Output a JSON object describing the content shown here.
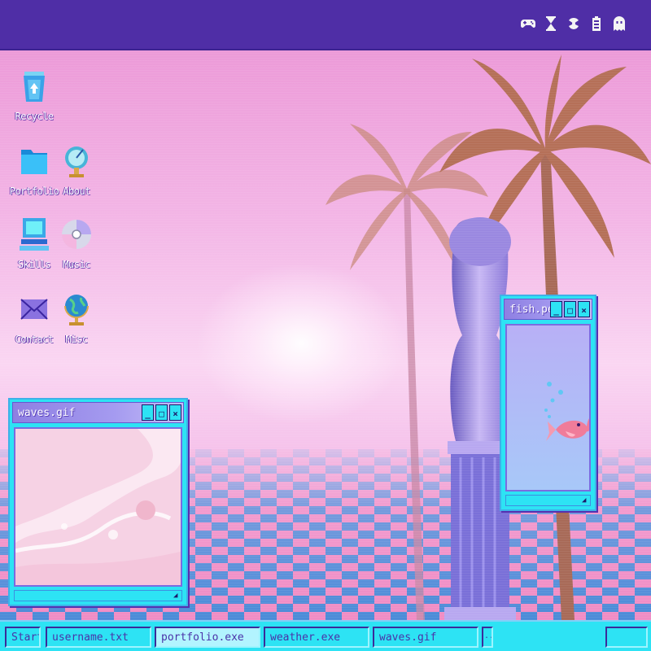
{
  "topbar": {
    "tray_icons": [
      {
        "name": "gamepad-icon",
        "glyph": "🎮"
      },
      {
        "name": "hourglass-icon",
        "glyph": "⧗"
      },
      {
        "name": "radiation-icon",
        "glyph": "☢"
      },
      {
        "name": "battery-icon",
        "glyph": "▮"
      },
      {
        "name": "ghost-icon",
        "glyph": "👻"
      }
    ]
  },
  "desktop": {
    "icons": [
      {
        "id": "recycle",
        "label": "Recycle",
        "icon": "recycle-bin-icon"
      },
      {
        "id": "portfolio",
        "label": "Portfolio",
        "icon": "folder-icon"
      },
      {
        "id": "about",
        "label": "About",
        "icon": "satellite-dish-icon"
      },
      {
        "id": "skills",
        "label": "Skills",
        "icon": "computer-icon"
      },
      {
        "id": "music",
        "label": "Music",
        "icon": "cd-icon"
      },
      {
        "id": "contact",
        "label": "Contact",
        "icon": "envelope-icon"
      },
      {
        "id": "misc",
        "label": "Misc",
        "icon": "globe-icon"
      }
    ]
  },
  "windows": {
    "waves": {
      "title": "waves.gif"
    },
    "fish": {
      "title": "fish.pet"
    },
    "buttons": {
      "minimize": "_",
      "maximize": "□",
      "close": "×"
    }
  },
  "taskbar": {
    "start_label": "Start",
    "tasks": [
      "username.txt",
      "portfolio.exe",
      "weather.exe",
      "waves.gif"
    ],
    "overflow_label": "..",
    "active_task": "portfolio.exe"
  },
  "colors": {
    "topbar": "#4f2ea6",
    "taskbar": "#2de3f4",
    "window_title": "#a59bf0",
    "sky": "#f3b6e6"
  }
}
